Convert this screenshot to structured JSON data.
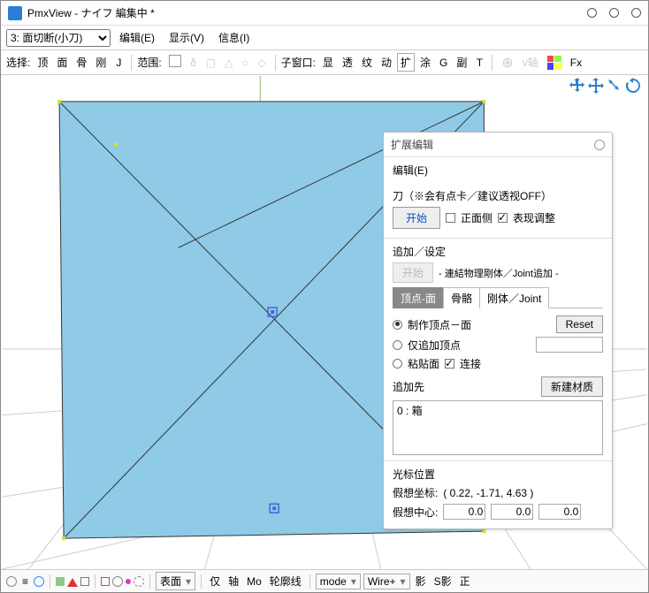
{
  "window": {
    "title": "PmxView - ナイフ 編集中 *"
  },
  "menubar": {
    "mode_selected": "3: 面切断(小刀)",
    "items": [
      "编辑(E)",
      "显示(V)",
      "信息(I)"
    ]
  },
  "toolbar": {
    "select_label": "选择:",
    "select_items": [
      "顶",
      "面",
      "骨",
      "刚",
      "J"
    ],
    "range_label": "范围:",
    "subwin_label": "子窗口:",
    "subwin_items": [
      "显",
      "透",
      "纹",
      "动",
      "扩",
      "涂",
      "G",
      "副",
      "T"
    ],
    "vaxis": "v轴",
    "fx": "Fx"
  },
  "panel": {
    "title": "扩展编辑",
    "edit": "编辑(E)",
    "knife": {
      "label": "刀（※会有点卡／建议透视OFF）",
      "start": "开始",
      "front_side": "正面侧",
      "adjust": "表现调整"
    },
    "add": {
      "label": "追加／设定",
      "start": "开始",
      "linked": "- 連結物理剛体／Joint追加 -",
      "tabs": [
        "顶点-面",
        "骨骼",
        "刚体／Joint"
      ],
      "opt_make": "制作顶点－面",
      "opt_only": "仅追加顶点",
      "opt_paste": "粘贴面",
      "connect": "连接",
      "reset": "Reset",
      "dest_label": "追加先",
      "dest_item": "0 : 箱",
      "new_mat": "新建材质"
    },
    "cursor": {
      "label": "光标位置",
      "coord_label": "假想坐标:",
      "coord_value": "( 0.22, -1.71, 4.63 )",
      "center_label": "假想中心:",
      "cx": "0.0",
      "cy": "0.0",
      "cz": "0.0"
    }
  },
  "statusbar": {
    "items1": [
      "仅",
      "轴",
      "Mo",
      "轮廓线"
    ],
    "surface": "表面",
    "mode": "mode",
    "wire": "Wire+",
    "shadow": "影",
    "sshadow": "S影",
    "ortho": "正"
  }
}
